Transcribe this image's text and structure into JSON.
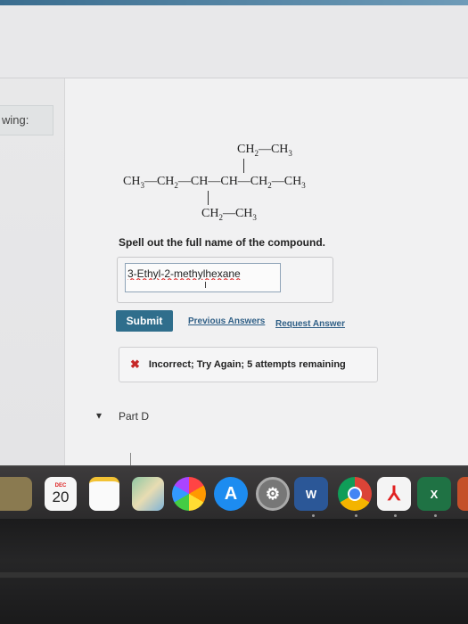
{
  "side_tab": {
    "label": "wing:"
  },
  "molecule": {
    "top_branch": [
      "CH",
      "2",
      "—CH",
      "3"
    ],
    "main_chain": [
      "CH",
      "3",
      "—CH",
      "2",
      "—CH—CH—CH",
      "2",
      "—CH",
      "3"
    ],
    "bottom_branch": [
      "CH",
      "2",
      "—CH",
      "3"
    ]
  },
  "question": {
    "text": "Spell out the full name of the compound."
  },
  "answer": {
    "value": "3-Ethyl-2-methylhexane"
  },
  "actions": {
    "submit_label": "Submit",
    "previous_answers_label": "Previous Answers",
    "request_answer_label": "Request Answer"
  },
  "feedback": {
    "text": "Incorrect; Try Again; 5 attempts remaining"
  },
  "next_part": {
    "label": "Part D"
  },
  "dock": {
    "calendar_month": "DEC",
    "calendar_day": "20",
    "word_letter": "W",
    "excel_letter": "X"
  },
  "colors": {
    "accent": "#2f6e8c",
    "link": "#2f5f86",
    "error": "#c62828"
  }
}
